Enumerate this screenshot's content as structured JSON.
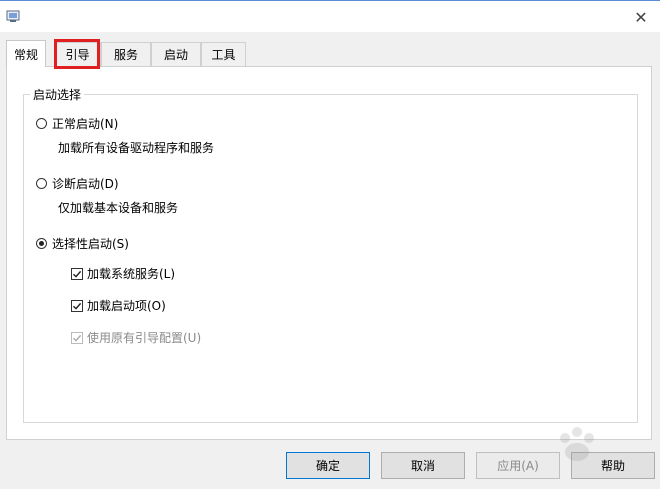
{
  "window": {
    "close_label": "✕"
  },
  "tabs": [
    {
      "label": "常规"
    },
    {
      "label": "引导"
    },
    {
      "label": "服务"
    },
    {
      "label": "启动"
    },
    {
      "label": "工具"
    }
  ],
  "startup": {
    "group_title": "启动选择",
    "options": [
      {
        "label": "正常启动(N)",
        "description": "加载所有设备驱动程序和服务",
        "selected": false
      },
      {
        "label": "诊断启动(D)",
        "description": "仅加载基本设备和服务",
        "selected": false
      },
      {
        "label": "选择性启动(S)",
        "selected": true
      }
    ],
    "selective_items": [
      {
        "label": "加载系统服务(L)",
        "checked": true,
        "enabled": true
      },
      {
        "label": "加载启动项(O)",
        "checked": true,
        "enabled": true
      },
      {
        "label": "使用原有引导配置(U)",
        "checked": true,
        "enabled": false
      }
    ]
  },
  "buttons": {
    "ok": "确定",
    "cancel": "取消",
    "apply": "应用(A)",
    "help": "帮助"
  },
  "colors": {
    "highlight": "#e02020",
    "accent": "#0078d7"
  }
}
